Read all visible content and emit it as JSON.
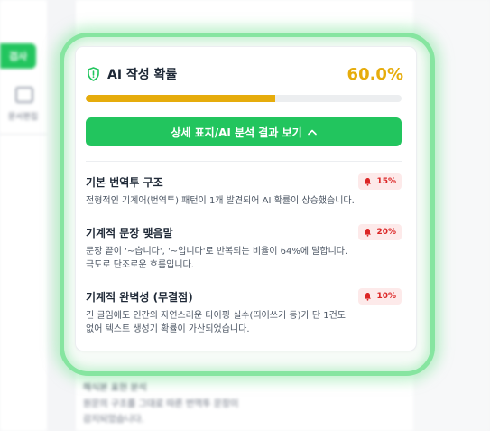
{
  "background": {
    "nav_button_label": "검사",
    "nav_item_label": "문서편집",
    "lower_title": "해식본 표현 분석",
    "lower_desc_line1": "원문의 구조를 그대로 따른 번역투 문장이",
    "lower_desc_line2": "감지되었습니다."
  },
  "card": {
    "title": "AI 작성 확률",
    "probability_text": "60.0%",
    "probability_fraction": 0.6,
    "details_button_label": "상세 표지/AI 분석 결과 보기",
    "items": [
      {
        "title": "기본 번역투 구조",
        "badge": "15%",
        "desc_lines": [
          "전형적인 기계어(번역투) 패턴이 1개 발견되어 AI 확률이 상승했습니다."
        ]
      },
      {
        "title": "기계적 문장 맺음말",
        "badge": "20%",
        "desc_lines": [
          "문장 끝이 '~습니다', '~입니다'로 반복되는 비율이 64%에 달합니다.",
          "극도로 단조로운 흐름입니다."
        ]
      },
      {
        "title": "기계적 완벽성 (무결점)",
        "badge": "10%",
        "desc_lines": [
          "긴 글임에도 인간의 자연스러운 타이핑 실수(띄어쓰기 등)가 단 1건도",
          "없어 텍스트 생성기 확률이 가산되었습니다."
        ]
      }
    ]
  },
  "colors": {
    "accent_green": "#22c55e",
    "probability_yellow": "#e6ac0c",
    "badge_red": "#dc2626",
    "highlight_glow": "#86e5a0"
  },
  "icons": {
    "header": "shield-check-icon",
    "button": "chevron-up-icon",
    "badge": "alarm-bell-icon"
  }
}
